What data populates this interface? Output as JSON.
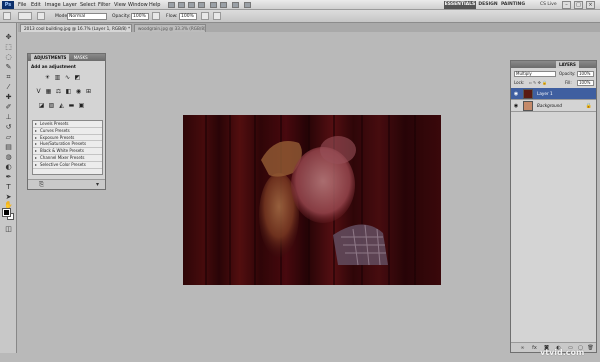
{
  "menubar": {
    "logo": "Ps",
    "items": [
      "File",
      "Edit",
      "Image",
      "Layer",
      "Select",
      "Filter",
      "View",
      "Window",
      "Help"
    ],
    "workspaces": [
      "ESSENTIALS",
      "DESIGN",
      "PAINTING"
    ],
    "cs_live": "CS Live",
    "window_controls": [
      "–",
      "□",
      "×"
    ]
  },
  "options": {
    "mode_label": "Mode:",
    "mode_value": "Normal",
    "opacity_label": "Opacity:",
    "opacity_value": "100%",
    "flow_label": "Flow:",
    "flow_value": "100%"
  },
  "doc_tabs": [
    {
      "label": "2013 cool building.jpg @ 16.7% (Layer 1, RGB/8) *",
      "active": true
    },
    {
      "label": "woodgrain.jpg @ 33.3% (RGB/8)",
      "active": false
    }
  ],
  "adjustments": {
    "tabs": [
      "ADJUSTMENTS",
      "MASKS"
    ],
    "add_label": "Add an adjustment",
    "presets": [
      "Levels Presets",
      "Curves Presets",
      "Exposure Presets",
      "Hue/Saturation Presets",
      "Black & White Presets",
      "Channel Mixer Presets",
      "Selective Color Presets"
    ]
  },
  "layers": {
    "tabs": [
      "LAYERS"
    ],
    "blend_mode": "Multiply",
    "opacity_label": "Opacity:",
    "opacity_value": "100%",
    "lock_label": "Lock:",
    "fill_label": "Fill:",
    "fill_value": "100%",
    "items": [
      {
        "name": "Layer 1",
        "selected": true
      },
      {
        "name": "Background",
        "selected": false
      }
    ]
  },
  "watermark": "vtvid.com",
  "colors": {
    "accent": "#3f5fa0",
    "foreground_swatch": "#000000",
    "background_swatch": "#ffffff"
  }
}
